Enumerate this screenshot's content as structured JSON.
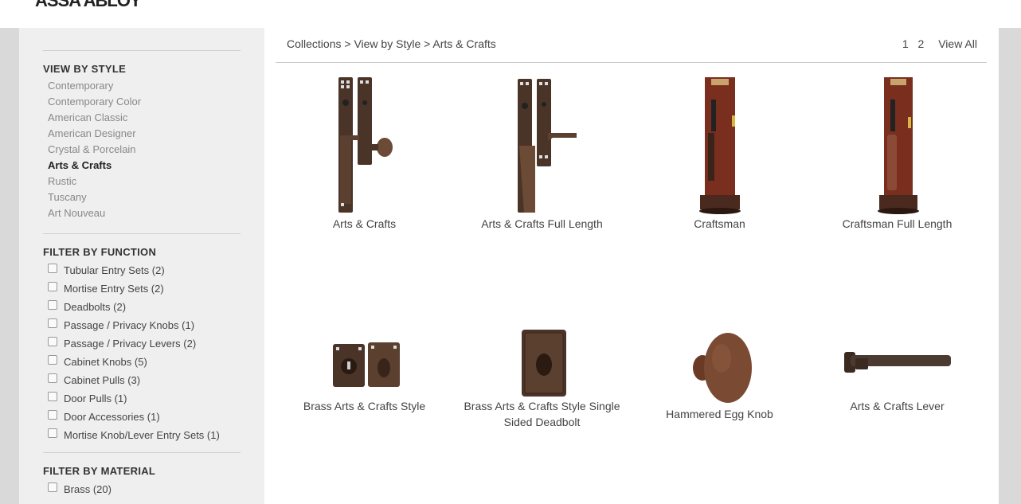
{
  "header": {
    "logo_text": "ASSA ABLOY"
  },
  "sidebar": {
    "view_by_style": {
      "title": "VIEW BY STYLE",
      "items": [
        "Contemporary",
        "Contemporary Color",
        "American Classic",
        "American Designer",
        "Crystal & Porcelain",
        "Arts & Crafts",
        "Rustic",
        "Tuscany",
        "Art Nouveau"
      ],
      "active": "Arts & Crafts"
    },
    "filter_by_function": {
      "title": "FILTER BY FUNCTION",
      "items": [
        "Tubular Entry Sets (2)",
        "Mortise Entry Sets (2)",
        "Deadbolts (2)",
        "Passage / Privacy Knobs (1)",
        "Passage / Privacy Levers (2)",
        "Cabinet Knobs (5)",
        "Cabinet Pulls (3)",
        "Door Pulls (1)",
        "Door Accessories (1)",
        "Mortise Knob/Lever Entry Sets (1)"
      ]
    },
    "filter_by_material": {
      "title": "FILTER BY MATERIAL",
      "items": [
        "Brass (20)"
      ]
    }
  },
  "breadcrumb": {
    "collections": "Collections",
    "sep1": " > ",
    "view_by_style": "View by Style",
    "sep2": " > ",
    "current": "Arts & Crafts"
  },
  "pagination": {
    "page1": "1",
    "page2": "2",
    "view_all": "View All"
  },
  "products": [
    {
      "name": "Arts & Crafts",
      "icon": "handleset-knob"
    },
    {
      "name": "Arts & Crafts Full Length",
      "icon": "handleset-lever"
    },
    {
      "name": "Craftsman",
      "icon": "mortise-handleset"
    },
    {
      "name": "Craftsman Full Length",
      "icon": "mortise-handleset-full"
    },
    {
      "name": "Brass Arts & Crafts Style",
      "icon": "double-deadbolt"
    },
    {
      "name": "Brass Arts & Crafts Style Single Sided Deadbolt",
      "icon": "single-deadbolt"
    },
    {
      "name": "Hammered Egg Knob",
      "icon": "egg-knob"
    },
    {
      "name": "Arts & Crafts Lever",
      "icon": "lever"
    }
  ],
  "colors": {
    "bronze": "#4a3428",
    "bronze_light": "#6b4a36",
    "copper": "#7a2e1e",
    "sidebar_bg": "#efefef"
  }
}
